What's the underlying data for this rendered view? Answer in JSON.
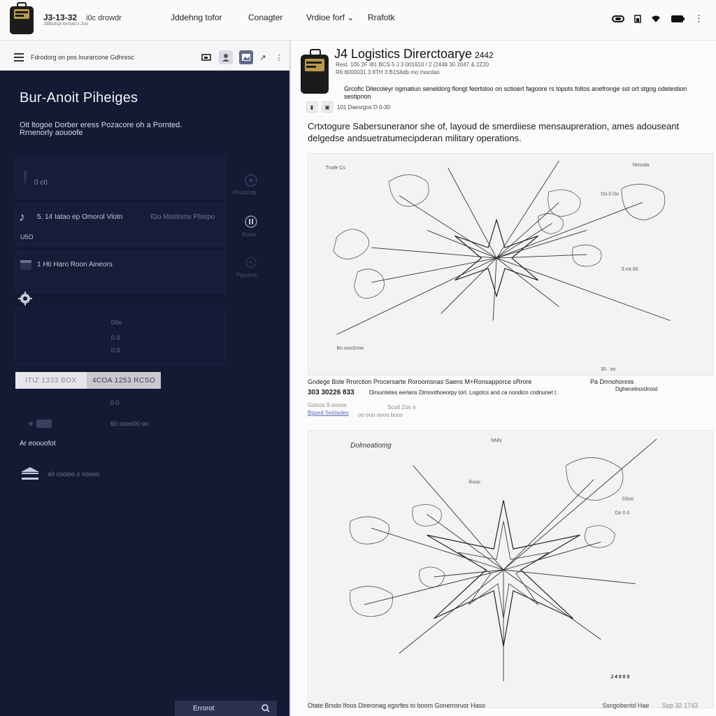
{
  "topbar": {
    "meta_time": "J3-13-32",
    "meta_sub": "Jdbcasa bnoacu Juo",
    "meta_dir": "i0c drowdr",
    "nav": [
      "Jddehng tofor",
      "Conagter",
      "Vrdioe forf",
      "Rrafotk"
    ],
    "status_icons": [
      "link-icon",
      "battery-icon",
      "wifi-icon",
      "battery-full-icon",
      "more-vertical-icon"
    ]
  },
  "left_toolbar": {
    "doc_label": "Fdrodorg on pos lourarcone Gdhresc",
    "buttons": [
      "cast-icon",
      "user-icon",
      "image-icon",
      "share-icon",
      "more-vertical-icon"
    ]
  },
  "left_panel": {
    "title": "Bur-Anoit Piheiges",
    "description_line1": "Oit ltogoe Dorber eress Pozacore oh a Pornted.",
    "description_line2": "Rrnenorly aouoofe",
    "card1_value": "0 c0",
    "side_labels": [
      "Prsoonds",
      "Roslo",
      "Ppooms"
    ],
    "row_music": "5. 14 Iatao ep Omorol Vlotn",
    "row_music_right": "IDo Mastoms Plsirpo",
    "row_music_sub": "U5O",
    "row_gallery": "1 Hti Haro Roon Aineors",
    "dim_values": [
      "00o",
      "0 0",
      "0 0"
    ],
    "segment": [
      "ITIZ 1333 BOX",
      "4COA 1253 RCSO"
    ],
    "dim_after_seg": "0 0",
    "dim_after_seg2": "60 sooo00 oo",
    "account_label": "Ar eoouofot",
    "footer_hint": "a9 cooloo o ooooo",
    "bottom_button": "Errorot"
  },
  "content": {
    "title": "J4  Logistics Direrctoarye",
    "title_num": "2442",
    "meta1": "Rest. 105 2F I81 BCS 5 J 3 001610 / 2 (2448 30 2047 & 2Z20",
    "meta2": "R6 6000031 3 8TH 3 B1S6db mo mocdan",
    "note": "Grcofic Dilecoleyr ogmatiun seneldorg flongt feortsloo on sctioert fagoore rs topots foltos anefronge sst ort stgog odetestion sestipnon",
    "actions_text": "101  Daesrgos D  0-30",
    "lead": "Crtxtogure Sabersuneranor she of, layoud de smerdiiese mensaupreration, ames adouseant delgedse andsuetratumecipderan military operations.",
    "figure1_labels": [
      "Tnofe Cs",
      "5 rot 00",
      "Oo 0 Do",
      "30 . oo",
      "Nmosla",
      "Bo oooSrme"
    ],
    "caption1_left": "Gndege Bste Rrorction Procersarte Roroomsnas Saens M+Ronsapporce sRrore",
    "caption1_right": "Pa Drrnohonnis",
    "caption1_bold": "303 30226 833",
    "caption1_line2": "Dirsuntetes eerlans Dimoothoeorpy torl. Logotcs and ca nondicn codnunet t.",
    "caption1_right2": "Dghecelnordnost",
    "caption1_line3a": "Goicos 9 oooos",
    "caption1_line3b": "Scod Zos o",
    "caption1_link": "Bgsed Setdades",
    "caption1_line4": "oo ooo   oooo boos",
    "figure2_title": "Dolmeatiomg",
    "figure2_labels": [
      "NNN",
      "Rooo",
      "SSoo",
      "Oo 0 0",
      "J 4 0 0 0"
    ],
    "bottom_caption": "Otate Brsdo Ifoos Direronag egsrfes to boom Gonerroruor Haso",
    "bottom_right": "Ssngobentd Hae",
    "bottom_right2": "Spp 32 1743"
  },
  "colors": {
    "left_bg": "#131a33",
    "right_bg": "#fbfbfc",
    "accent_link": "#5a6fb8"
  }
}
